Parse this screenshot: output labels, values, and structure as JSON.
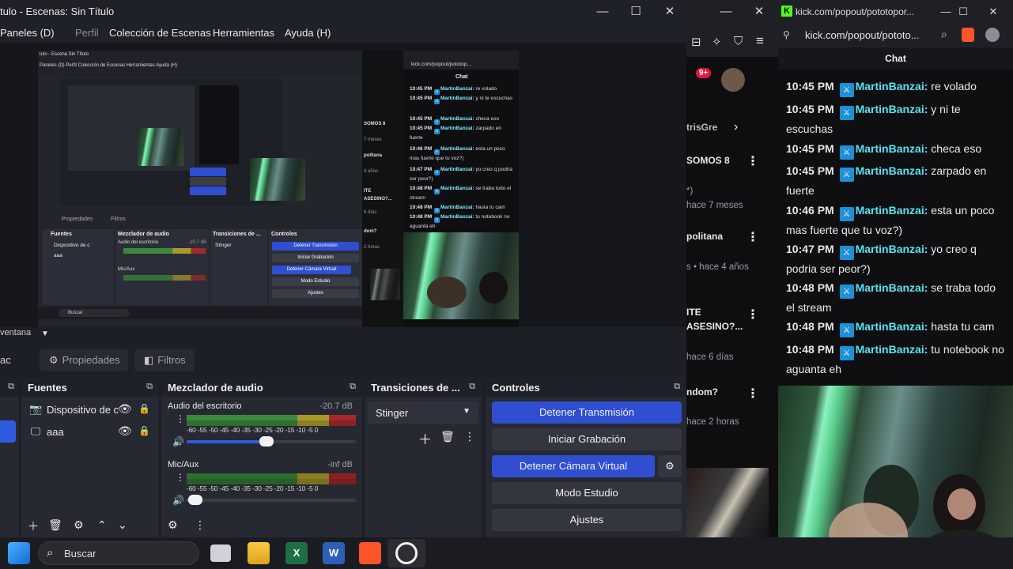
{
  "obs": {
    "title": "tulo - Escenas: Sin Título",
    "window_controls": {
      "minimize": "—",
      "maximize": "☐",
      "close": "✕"
    },
    "menu": [
      "Paneles (D)",
      "Perfil",
      "Colección de Escenas",
      "Herramientas",
      "Ayuda (H)"
    ],
    "scene_label": "ventana",
    "tabs": {
      "scene_fragment": "ac",
      "properties": "Propiedades",
      "filters": "Filtros"
    },
    "docks": {
      "sources": {
        "title": "Fuentes",
        "items": [
          {
            "name": "Dispositivo de c",
            "icon": "camera-icon"
          },
          {
            "name": "aaa",
            "icon": "monitor-icon"
          }
        ]
      },
      "mixer": {
        "title": "Mezclador de audio",
        "channels": [
          {
            "name": "Audio del escritorio",
            "db": "-20.7 dB",
            "level": 0.9,
            "volume": 0.47
          },
          {
            "name": "Mic/Aux",
            "db": "-inf dB",
            "level": 0.0,
            "volume": 0.05
          }
        ],
        "ticks": "-60 -55 -50 -45 -40 -35 -30 -25 -20 -15 -10 -5 0"
      },
      "transitions": {
        "title": "Transiciones de ...",
        "selected": "Stinger"
      },
      "controls": {
        "title": "Controles",
        "buttons": {
          "stop_stream": "Detener Transmisión",
          "start_record": "Iniciar Grabación",
          "stop_virtual_cam": "Detener Cámara Virtual",
          "studio_mode": "Modo Estudio",
          "settings": "Ajustes"
        }
      }
    }
  },
  "nested_preview": {
    "title": "tulo - Escena Sin Título",
    "menu": "Paneles (D)   Perfil   Colección de Escenas   Herramientas   Ayuda (H)",
    "tabs": {
      "properties": "Propiedades",
      "filters": "Filtros"
    },
    "dock_titles": {
      "sources": "Fuentes",
      "mixer": "Mezclador de audio",
      "transitions": "Transiciones de ...",
      "controls": "Controles"
    },
    "sources": [
      "Dispositivo de c",
      "aaa"
    ],
    "mixer_channels": [
      "Audio del escritorio",
      "Mic/Aux"
    ],
    "mixer_db": "-20.7 dB",
    "transition": "Stinger",
    "buttons": [
      "Detener Transmisión",
      "Iniciar Grabación",
      "Detener Cámara Virtual",
      "Modo Estudio",
      "Ajustes"
    ],
    "search": "Buscar",
    "url": "kick.com/popout/pototop...",
    "chat_header": "Chat",
    "chat": [
      {
        "time": "10:45 PM",
        "user": "MartinBanzai",
        "text": "re volado"
      },
      {
        "time": "10:45 PM",
        "user": "MartinBanzai",
        "text": "y ni te escuchas"
      },
      {
        "time": "10:45 PM",
        "user": "MartinBanzai",
        "text": "checa eso"
      },
      {
        "time": "10:45 PM",
        "user": "MartinBanzai",
        "text": "zarpado en fuerte"
      },
      {
        "time": "10:46 PM",
        "user": "MartinBanzai",
        "text": "esta un poco mas fuerte que tu voz?)"
      },
      {
        "time": "10:47 PM",
        "user": "MartinBanzai",
        "text": "yo creo q podria ser peor?)"
      },
      {
        "time": "10:48 PM",
        "user": "MartinBanzai",
        "text": "se traba todo el stream"
      },
      {
        "time": "10:48 PM",
        "user": "MartinBanzai",
        "text": "hasta tu cam"
      },
      {
        "time": "10:48 PM",
        "user": "MartinBanzai",
        "text": "tu notebook no aguanta eh"
      }
    ],
    "strip": [
      "SOMOS 8",
      "7 meses",
      "politana",
      "4 años",
      "ITE",
      "ASESINO?...",
      "6 días",
      "dom?",
      "2 horas"
    ]
  },
  "browser": {
    "window_controls": {
      "minimize": "—",
      "maximize": "☐",
      "close": "✕"
    },
    "notification_count": "9+",
    "items": [
      {
        "title": "trisGre",
        "meta": ""
      },
      {
        "title": "SOMOS 8",
        "meta": ""
      },
      {
        "title": "*)",
        "meta": "hace 7 meses"
      },
      {
        "title": "politana",
        "meta": ""
      },
      {
        "title": "",
        "meta": "s • hace 4 años"
      },
      {
        "title": "ITE",
        "meta": ""
      },
      {
        "title": "ASESINO?...",
        "meta": ""
      },
      {
        "title": "",
        "meta": "hace 6 días"
      },
      {
        "title": "ndom?",
        "meta": ""
      },
      {
        "title": "",
        "meta": "hace 2 horas"
      }
    ]
  },
  "kick": {
    "tab_title": "kick.com/popout/pototopor...",
    "url": "kick.com/popout/pototo...",
    "window_controls": {
      "minimize": "—",
      "maximize": "☐",
      "close": "✕"
    },
    "chat_header": "Chat",
    "messages": [
      {
        "time": "10:45 PM",
        "user": "MartinBanzai",
        "text": "re volado"
      },
      {
        "time": "10:45 PM",
        "user": "MartinBanzai",
        "text": "y ni te escuchas"
      },
      {
        "time": "10:45 PM",
        "user": "MartinBanzai",
        "text": "checa eso"
      },
      {
        "time": "10:45 PM",
        "user": "MartinBanzai",
        "text": "zarpado en fuerte"
      },
      {
        "time": "10:46 PM",
        "user": "MartinBanzai",
        "text": "esta un poco mas fuerte que tu voz?)"
      },
      {
        "time": "10:47 PM",
        "user": "MartinBanzai",
        "text": "yo creo q podria ser peor?)"
      },
      {
        "time": "10:48 PM",
        "user": "MartinBanzai",
        "text": "se traba todo el stream"
      },
      {
        "time": "10:48 PM",
        "user": "MartinBanzai",
        "text": "hasta tu cam"
      },
      {
        "time": "10:48 PM",
        "user": "MartinBanzai",
        "text": "tu notebook no aguanta eh"
      }
    ]
  },
  "taskbar": {
    "search_placeholder": "Buscar",
    "apps": [
      "start-icon",
      "task-view-icon",
      "file-explorer-icon",
      "excel-icon",
      "word-icon",
      "brave-icon",
      "obs-icon"
    ]
  },
  "colors": {
    "accent_button": "#2f4fd0",
    "chat_username": "#59e4f2",
    "kick_green": "#53fc18",
    "meter_green": "#3b8a3b",
    "meter_yellow": "#a89a2a",
    "meter_red": "#a32a2a"
  }
}
